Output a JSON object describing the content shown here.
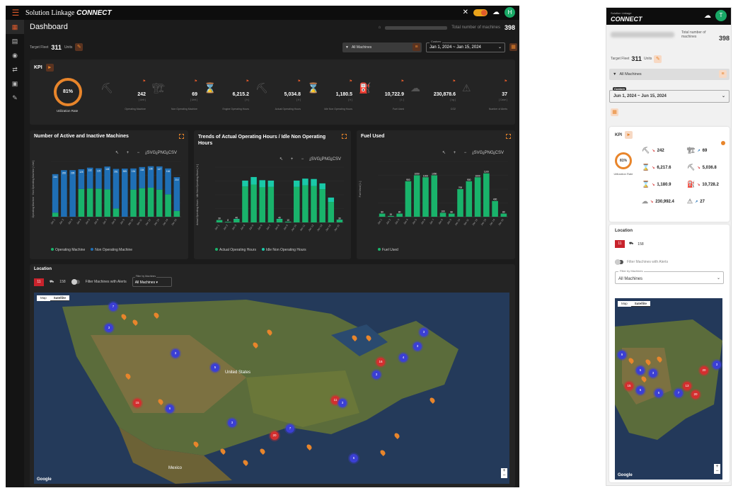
{
  "desktop": {
    "brand": "Solution Linkage",
    "brand_bold": "CONNECT",
    "avatar": "H",
    "dashboard_title": "Dashboard",
    "total_label": "Total number of machines",
    "total_value": "398",
    "target_label": "Target Fleet",
    "target_value": "311",
    "target_unit": "Units",
    "filter_value": "All Machines",
    "date_label": "Custom",
    "date_value": "Jan 1, 2024 ~ Jan 15, 2024",
    "kpi": {
      "title": "KPI",
      "utilization_value": "81%",
      "utilization_label": "Utilization Rate",
      "items": [
        {
          "icon": "excavator-icon",
          "glyph": "⛏",
          "value": "242",
          "unit": "[ Unit ]",
          "label": "Operating Machine"
        },
        {
          "icon": "crane-icon",
          "glyph": "🏗",
          "value": "69",
          "unit": "[ Unit ]",
          "label": "Non Operating Machine"
        },
        {
          "icon": "hourglass-icon",
          "glyph": "⌛",
          "value": "6,215.2",
          "unit": "[ h ]",
          "label": "Engine Operating Hours"
        },
        {
          "icon": "excavator-icon",
          "glyph": "⛏",
          "value": "5,034.8",
          "unit": "[ h ]",
          "label": "Actual Operating Hours"
        },
        {
          "icon": "hourglass-icon",
          "glyph": "⌛",
          "value": "1,180.5",
          "unit": "[ h ]",
          "label": "Idle Non Operating Hours"
        },
        {
          "icon": "fuel-icon",
          "glyph": "⛽",
          "value": "10,722.9",
          "unit": "[ L ]",
          "label": "Fuel Used"
        },
        {
          "icon": "co2-icon",
          "glyph": "☁",
          "value": "230,878.6",
          "unit": "[ kg ]",
          "label": "CO2"
        },
        {
          "icon": "alert-icon",
          "glyph": "⚠",
          "value": "37",
          "unit": "[ Case ]",
          "label": "Number of Alerts"
        }
      ]
    },
    "location": {
      "title": "Location",
      "red_count": "11",
      "machine_count": "158",
      "filter_alerts_label": "Filter Machines with Alerts",
      "filter_by_label": "Filter by Machines",
      "filter_by_value": "All Machines",
      "map_tab_map": "Map",
      "map_tab_satellite": "Satellite",
      "google": "Google",
      "map_labels": {
        "us": "United States",
        "mexico": "Mexico"
      }
    }
  },
  "chart_data": [
    {
      "type": "bar",
      "title": "Number of Active and Inactive Machines",
      "ylabel": "Operating Machine · Non Operating Machine [ Unit ]",
      "ylim": [
        0,
        350
      ],
      "categories": [
        "Jan 1",
        "Jan 2",
        "Jan 3",
        "Jan 4",
        "Jan 5",
        "Jan 6",
        "Jan 7",
        "Jan 8",
        "Jan 9",
        "Jan 10",
        "Jan 11",
        "Jan 12",
        "Jan 13",
        "Jan 14",
        "Jan 15"
      ],
      "series": [
        {
          "name": "Operating Machine",
          "color": "#19b36b",
          "values": [
            26,
            0,
            0,
            176,
            179,
            178,
            173,
            52,
            0,
            172,
            181,
            184,
            172,
            142,
            37
          ]
        },
        {
          "name": "Non Operating Machine",
          "color": "#1f6fb5",
          "values": [
            244,
            295,
            295,
            125,
            132,
            129,
            145,
            251,
            305,
            134,
            134,
            136,
            147,
            164,
            214
          ]
        }
      ],
      "toolbar": [
        "↖",
        "+",
        "−",
        "⤓SVG",
        "⤓PNG",
        "⤓CSV"
      ]
    },
    {
      "type": "bar",
      "title": "Trends of Actual Operating Hours / Idle Non Operating Hours",
      "ylabel": "Actual Operating Hours · Idle Non Operating Hours [ h ]",
      "categories": [
        "Jan 1",
        "Jan 2",
        "Jan 3",
        "Jan 4",
        "Jan 5",
        "Jan 6",
        "Jan 7",
        "Jan 8",
        "Jan 9",
        "Jan 10",
        "Jan 11",
        "Jan 12",
        "Jan 13",
        "Jan 14",
        "Jan 15"
      ],
      "series": [
        {
          "name": "Actual Operating Hours",
          "color": "#19b36b",
          "values": [
            30,
            8,
            40,
            455,
            480,
            445,
            450,
            40,
            10,
            450,
            470,
            460,
            420,
            260,
            30
          ]
        },
        {
          "name": "Idle Non Operating Hours",
          "color": "#19c9a8",
          "values": [
            0,
            0,
            5,
            75,
            95,
            90,
            80,
            5,
            0,
            80,
            85,
            90,
            75,
            55,
            5
          ]
        }
      ],
      "ylim": [
        0,
        700
      ],
      "toolbar": [
        "↖",
        "+",
        "−",
        "⤓SVG",
        "⤓PNG",
        "⤓CSV"
      ]
    },
    {
      "type": "bar",
      "title": "Fuel Used",
      "ylabel": "Fuel Used [ L ]",
      "ylim": [
        0,
        1400
      ],
      "categories": [
        "Jan 1",
        "Jan 2",
        "Jan 3",
        "Jan 4",
        "Jan 5",
        "Jan 6",
        "Jan 7",
        "Jan 8",
        "Jan 9",
        "Jan 10",
        "Jan 11",
        "Jan 12",
        "Jan 13",
        "Jan 14",
        "Jan 15"
      ],
      "series": [
        {
          "name": "Fuel Used",
          "color": "#19b36b",
          "values": [
            80,
            20,
            80,
            900,
            1050,
            1000,
            1050,
            100,
            80,
            700,
            900,
            1000,
            1100,
            400,
            80
          ]
        }
      ],
      "toolbar": [
        "↖",
        "+",
        "−",
        "⤓SVG",
        "⤓PNG",
        "⤓CSV"
      ]
    }
  ],
  "mobile": {
    "brand_small": "Solution Linkage",
    "brand": "CONNECT",
    "avatar": "T",
    "total_label": "Total number of machines",
    "total_value": "398",
    "target_label": "Target Fleet",
    "target_value": "311",
    "target_unit": "Units",
    "filter_value": "All Machines",
    "date_label": "Custom",
    "date_value": "Jun 1, 2024 ~ Jun 15, 2024",
    "kpi_title": "KPI",
    "utilization_value": "81%",
    "utilization_label": "Utilization Rate",
    "kpis": [
      {
        "icon": "excavator-icon",
        "glyph": "⛏",
        "value": "242",
        "dir": "↘",
        "unit": "[ Unit ]"
      },
      {
        "icon": "crane-icon",
        "glyph": "🏗",
        "value": "69",
        "dir": "↗",
        "unit": "[ Unit ]"
      },
      {
        "icon": "hourglass-icon",
        "glyph": "⌛",
        "value": "6,217.6",
        "dir": "↘",
        "unit": "[ h ]"
      },
      {
        "icon": "excavator-icon",
        "glyph": "⛏",
        "value": "5,036.8",
        "dir": "↘",
        "unit": "[ h ]"
      },
      {
        "icon": "hourglass-icon",
        "glyph": "⌛",
        "value": "1,180.9",
        "dir": "↘",
        "unit": "[ h ]"
      },
      {
        "icon": "fuel-icon",
        "glyph": "⛽",
        "value": "10,728.2",
        "dir": "↘",
        "unit": "[ L ]"
      },
      {
        "icon": "co2-icon",
        "glyph": "☁",
        "value": "230,992.4",
        "dir": "↘",
        "unit": "[ kg ]"
      },
      {
        "icon": "alert-icon",
        "glyph": "⚠",
        "value": "27",
        "dir": "↗",
        "unit": "[ Case ]"
      }
    ],
    "location_title": "Location",
    "red_count": "11",
    "machine_count": "158",
    "filter_alerts_label": "Filter Machines with Alerts",
    "filter_by_label": "Filter by Machines",
    "filter_by_value": "All Machines",
    "map_tab_map": "Map",
    "map_tab_satellite": "Satellite",
    "google": "Google"
  },
  "colors": {
    "accent": "#e8852b",
    "alert": "#d32f2f",
    "operating": "#19b36b",
    "non_operating": "#1f6fb5",
    "cluster": "#3b3fd4"
  }
}
